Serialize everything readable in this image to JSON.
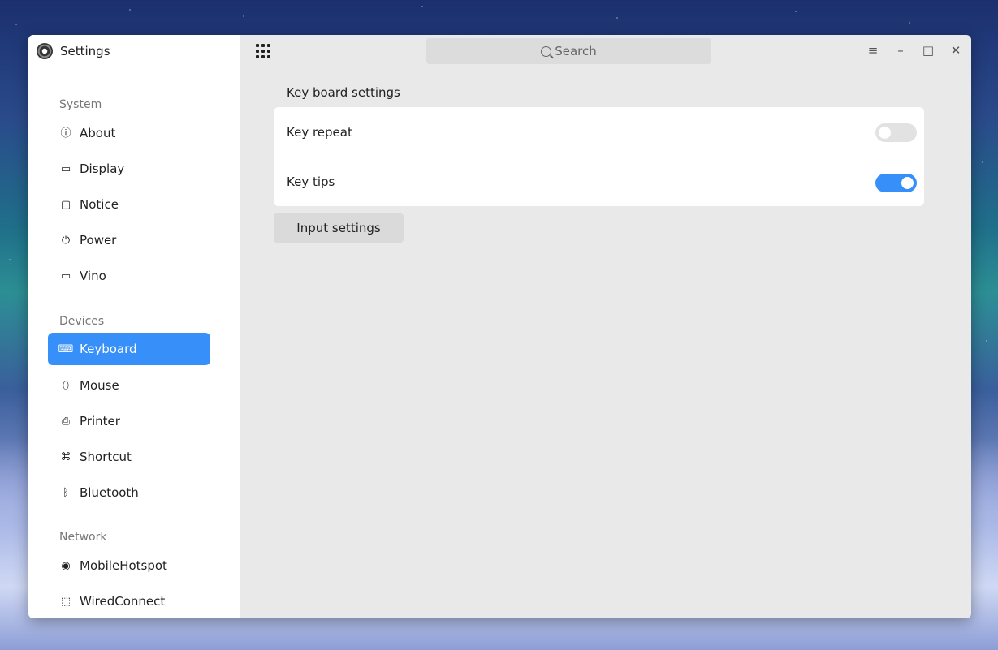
{
  "app": {
    "title": "Settings",
    "icon": "settings-gear-icon"
  },
  "search": {
    "placeholder": "Search"
  },
  "sidebar": {
    "sections": [
      {
        "label": "System",
        "items": [
          {
            "label": "About",
            "icon": "info-icon",
            "glyph": "ⓘ"
          },
          {
            "label": "Display",
            "icon": "monitor-icon",
            "glyph": "▭"
          },
          {
            "label": "Notice",
            "icon": "message-icon",
            "glyph": "▢"
          },
          {
            "label": "Power",
            "icon": "power-icon",
            "glyph": "⏻"
          },
          {
            "label": "Vino",
            "icon": "remote-desktop-icon",
            "glyph": "▭"
          }
        ]
      },
      {
        "label": "Devices",
        "items": [
          {
            "label": "Keyboard",
            "icon": "keyboard-icon",
            "glyph": "⌨",
            "active": true
          },
          {
            "label": "Mouse",
            "icon": "mouse-icon",
            "glyph": "⬯"
          },
          {
            "label": "Printer",
            "icon": "printer-icon",
            "glyph": "⎙"
          },
          {
            "label": "Shortcut",
            "icon": "shortcut-icon",
            "glyph": "⌘"
          },
          {
            "label": "Bluetooth",
            "icon": "bluetooth-icon",
            "glyph": "ᛒ"
          }
        ]
      },
      {
        "label": "Network",
        "items": [
          {
            "label": "MobileHotspot",
            "icon": "hotspot-icon",
            "glyph": "◉"
          },
          {
            "label": "WiredConnect",
            "icon": "wired-network-icon",
            "glyph": "⬚"
          }
        ]
      }
    ]
  },
  "main": {
    "group_title": "Key board settings",
    "rows": [
      {
        "label": "Key repeat",
        "enabled": false
      },
      {
        "label": "Key tips",
        "enabled": true
      }
    ],
    "input_settings_label": "Input settings"
  },
  "window_controls": {
    "menu": "≡",
    "minimize": "–",
    "maximize": "□",
    "close": "✕"
  },
  "colors": {
    "accent": "#3790fa",
    "toggle_off": "#e2e2e2",
    "sidebar_bg": "#ffffff",
    "content_bg": "#e9e9e9"
  }
}
